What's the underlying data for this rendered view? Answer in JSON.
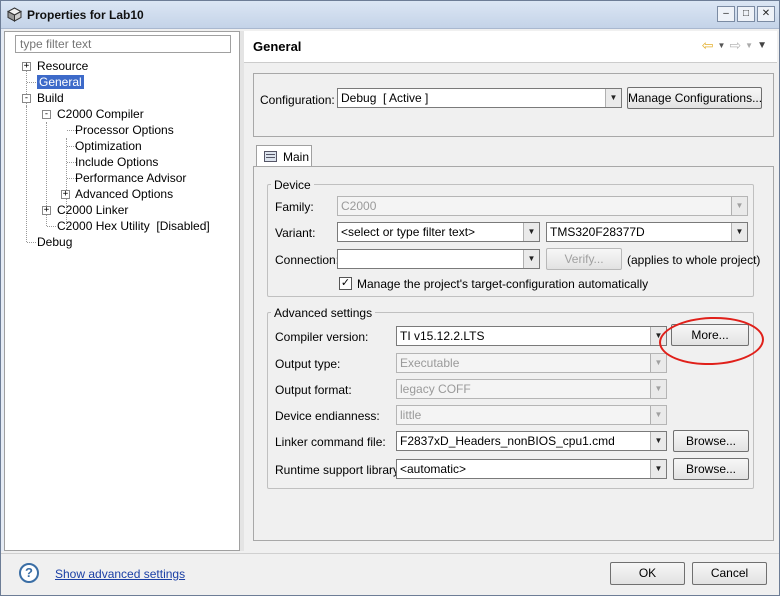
{
  "window": {
    "title": "Properties for Lab10",
    "minimize_icon": "minimize-icon",
    "maximize_icon": "maximize-icon",
    "close_icon": "close-icon"
  },
  "sidebar": {
    "filter_placeholder": "type filter text",
    "items": [
      {
        "label": "Resource"
      },
      {
        "label": "General"
      },
      {
        "label": "Build"
      },
      {
        "label": "C2000 Compiler"
      },
      {
        "label": "Processor Options"
      },
      {
        "label": "Optimization"
      },
      {
        "label": "Include Options"
      },
      {
        "label": "Performance Advisor"
      },
      {
        "label": "Advanced Options"
      },
      {
        "label": "C2000 Linker"
      },
      {
        "label": "C2000 Hex Utility  [Disabled]"
      },
      {
        "label": "Debug"
      }
    ]
  },
  "header": {
    "title": "General"
  },
  "configuration": {
    "label": "Configuration:",
    "value": "Debug  [ Active ]",
    "manage_button": "Manage Configurations..."
  },
  "tabs": [
    {
      "label": "Main"
    }
  ],
  "device": {
    "group_title": "Device",
    "family_label": "Family:",
    "family_value": "C2000",
    "variant_label": "Variant:",
    "variant_filter": "<select or type filter text>",
    "variant_value": "TMS320F28377D",
    "connection_label": "Connection:",
    "connection_value": "",
    "verify_button": "Verify...",
    "connection_note": "(applies to whole project)",
    "manage_checkbox_label": "Manage the project's target-configuration automatically",
    "manage_checked": true
  },
  "advanced": {
    "group_title": "Advanced settings",
    "compiler_label": "Compiler version:",
    "compiler_value": "TI v15.12.2.LTS",
    "more_button": "More...",
    "output_type_label": "Output type:",
    "output_type_value": "Executable",
    "output_format_label": "Output format:",
    "output_format_value": "legacy COFF",
    "endianness_label": "Device endianness:",
    "endianness_value": "little",
    "linker_label": "Linker command file:",
    "linker_value": "F2837xD_Headers_nonBIOS_cpu1.cmd",
    "runtime_label": "Runtime support library:",
    "runtime_value": "<automatic>",
    "browse_button": "Browse..."
  },
  "footer": {
    "help_link": "Show advanced settings",
    "ok_button": "OK",
    "cancel_button": "Cancel"
  },
  "colors": {
    "selection": "#3d6ac9",
    "annotation": "#e0201a",
    "link": "#1a3fa5"
  }
}
